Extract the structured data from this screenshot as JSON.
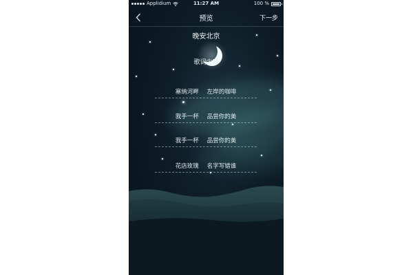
{
  "status_bar": {
    "carrier": "Applidium",
    "time": "11:27 AM",
    "battery": "100 %",
    "battery_level": 1.0
  },
  "nav": {
    "back_icon": "chevron-left-icon",
    "title": "预览",
    "next_label": "下一步"
  },
  "preview": {
    "song_title": "晚安北京",
    "moon_icon": "crescent-moon-icon",
    "lyrics_placeholder": "歌词内容",
    "lines": [
      {
        "left": "塞纳河畔",
        "right": "左岸的咖啡"
      },
      {
        "left": "我手一杯",
        "right": "品尝你的美"
      },
      {
        "left": "我手一杯",
        "right": "品尝你的美"
      },
      {
        "left": "花店玫瑰",
        "right": "名字写错谁"
      }
    ]
  },
  "colors": {
    "sky_dark": "#07111a",
    "sky_mid": "#0d1c27",
    "nebula_teal": "#2e5e66",
    "text": "#eef4f7"
  }
}
